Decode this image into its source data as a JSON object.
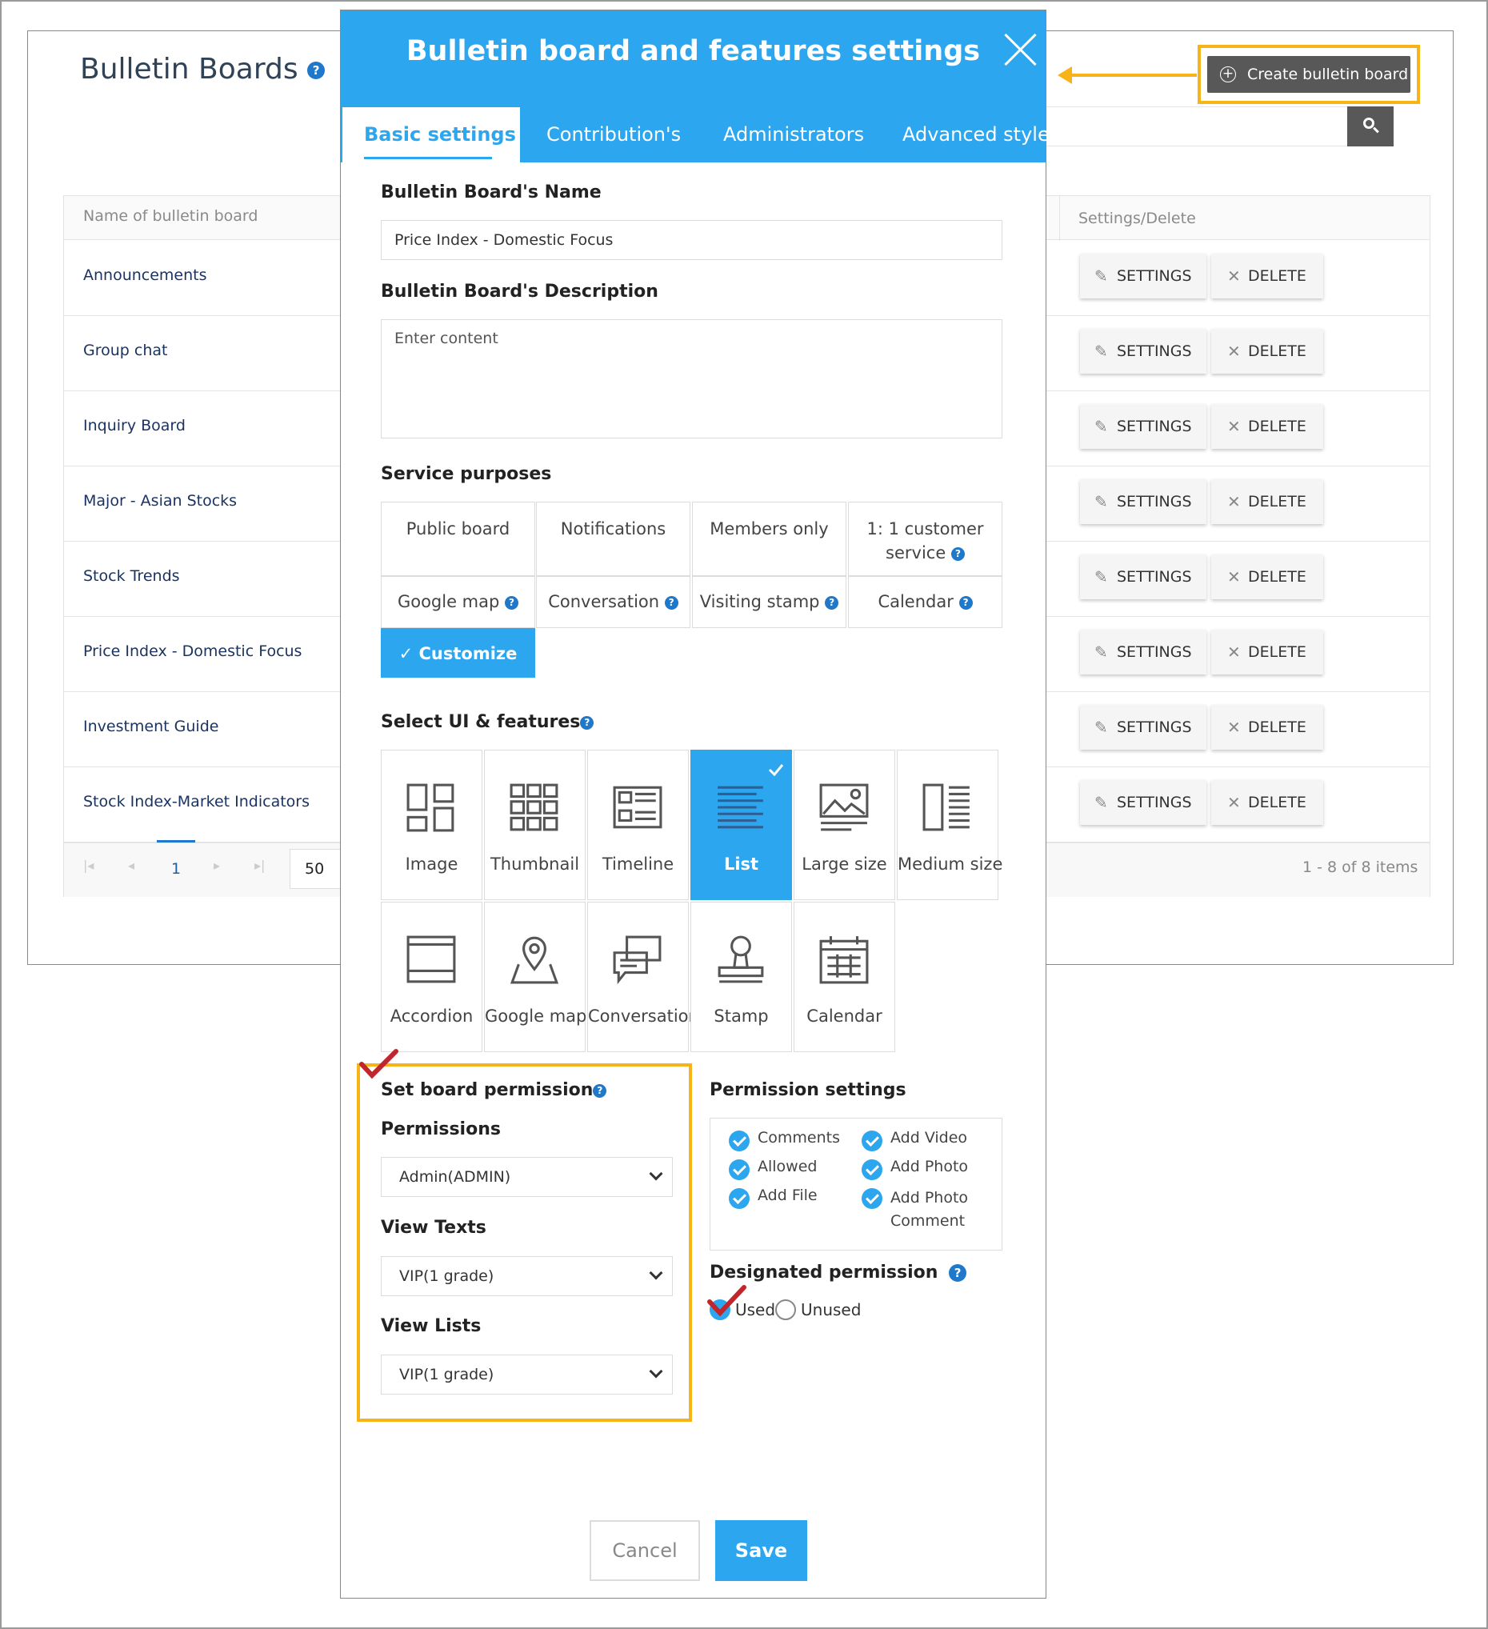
{
  "page": {
    "title": "Bulletin Boards",
    "create_button": "Create bulletin board",
    "search_icon": "search-icon",
    "columns": [
      "Name of bulletin board",
      "Settings/Delete"
    ],
    "rows": [
      {
        "name": "Announcements"
      },
      {
        "name": "Group chat"
      },
      {
        "name": "Inquiry Board"
      },
      {
        "name": "Major - Asian Stocks"
      },
      {
        "name": "Stock Trends"
      },
      {
        "name": "Price Index - Domestic Focus"
      },
      {
        "name": "Investment Guide"
      },
      {
        "name": "Stock Index-Market Indicators"
      }
    ],
    "settings_label": "SETTINGS",
    "delete_label": "DELETE",
    "pager": {
      "current": "1",
      "page_size": "50",
      "info": "1 - 8 of 8 items"
    }
  },
  "modal": {
    "title": "Bulletin board and features settings",
    "tabs": [
      {
        "label": "Basic settings",
        "active": true
      },
      {
        "label": "Contribution's"
      },
      {
        "label": "Administrators"
      },
      {
        "label": "Advanced style"
      }
    ],
    "name_label": "Bulletin Board's Name",
    "name_value": "Price Index - Domestic Focus",
    "desc_label": "Bulletin Board's Description",
    "desc_placeholder": "Enter content",
    "service_label": "Service purposes",
    "service_items": [
      "Public board",
      "Notifications",
      "Members only",
      "1: 1 customer service",
      "Google map",
      "Conversation",
      "Visiting stamp",
      "Calendar"
    ],
    "customize_label": "Customize",
    "ui_label": "Select UI & features",
    "ui_items": [
      "Image",
      "Thumbnail",
      "Timeline",
      "List",
      "Large size",
      "Medium size",
      "Accordion",
      "Google map",
      "Conversation",
      "Stamp",
      "Calendar"
    ],
    "ui_selected": "List",
    "board_perm_label": "Set board permission",
    "permissions_label": "Permissions",
    "permissions_value": "Admin(ADMIN)",
    "view_texts_label": "View Texts",
    "view_texts_value": "VIP(1 grade)",
    "view_lists_label": "View Lists",
    "view_lists_value": "VIP(1 grade)",
    "perm_settings_label": "Permission settings",
    "perm_settings": [
      "Comments",
      "Allowed",
      "Add File",
      "Add Video",
      "Add Photo",
      "Add Photo Comment"
    ],
    "designated_label": "Designated permission",
    "used_label": "Used",
    "unused_label": "Unused",
    "designated_value": "Used",
    "cancel_label": "Cancel",
    "save_label": "Save"
  },
  "colors": {
    "accent": "#2ba6ef",
    "highlight": "#f7b318",
    "dark_button": "#585858",
    "annotation": "#c0262b"
  }
}
